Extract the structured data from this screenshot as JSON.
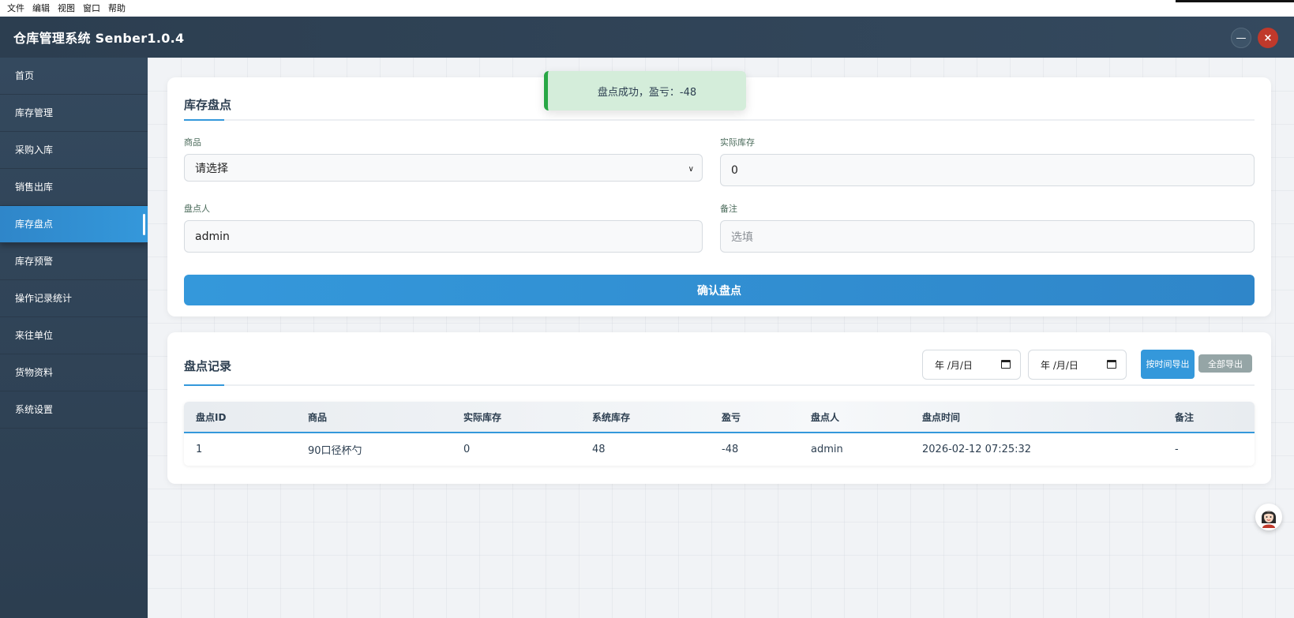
{
  "menubar": {
    "items": [
      "文件",
      "编辑",
      "视图",
      "窗口",
      "帮助"
    ]
  },
  "app": {
    "title": "仓库管理系统 Senber1.0.4",
    "minimize_label": "—",
    "close_label": "×"
  },
  "sidebar": {
    "items": [
      {
        "label": "首页"
      },
      {
        "label": "库存管理"
      },
      {
        "label": "采购入库"
      },
      {
        "label": "销售出库"
      },
      {
        "label": "库存盘点",
        "active": true
      },
      {
        "label": "库存预警"
      },
      {
        "label": "操作记录统计"
      },
      {
        "label": "来往单位"
      },
      {
        "label": "货物资料"
      },
      {
        "label": "系统设置"
      }
    ]
  },
  "toast": {
    "message": "盘点成功，盈亏：-48",
    "color": "#d4edda"
  },
  "check_form": {
    "title": "库存盘点",
    "product_label": "商品",
    "product_value": "请选择",
    "actual_label": "实际库存",
    "actual_value": "0",
    "checker_label": "盘点人",
    "checker_value": "admin",
    "note_label": "备注",
    "note_placeholder": "选填",
    "confirm_label": "确认盘点"
  },
  "records": {
    "title": "盘点记录",
    "date_start": "年 /月/日",
    "date_end": "年 /月/日",
    "export_by_time_label": "按时间导出",
    "export_all_label": "全部导出",
    "columns": [
      "盘点ID",
      "商品",
      "实际库存",
      "系统库存",
      "盈亏",
      "盘点人",
      "盘点时间",
      "备注"
    ],
    "rows": [
      [
        "1",
        "90口径杯勺",
        "0",
        "48",
        "-48",
        "admin",
        "2026-02-12 07:25:32",
        "-"
      ]
    ]
  },
  "colors": {
    "header": "#2c3e50",
    "accent": "#3498db",
    "danger": "#c0392b",
    "success": "#28a745"
  }
}
